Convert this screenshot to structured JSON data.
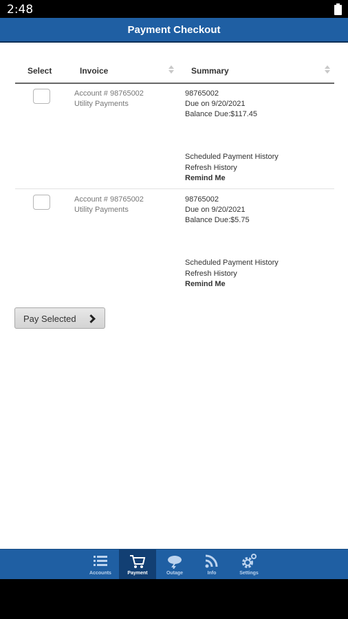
{
  "status_bar": {
    "time": "2:48"
  },
  "header": {
    "title": "Payment Checkout"
  },
  "table": {
    "columns": {
      "select": "Select",
      "invoice": "Invoice",
      "summary": "Summary"
    },
    "rows": [
      {
        "account": "Account # 98765002",
        "type": "Utility Payments",
        "number": "98765002",
        "due": "Due on 9/20/2021",
        "balance": "Balance Due:$117.45",
        "history_link": "Scheduled Payment History",
        "refresh_link": "Refresh History",
        "remind_link": "Remind Me"
      },
      {
        "account": "Account # 98765002",
        "type": "Utility Payments",
        "number": "98765002",
        "due": "Due on 9/20/2021",
        "balance": "Balance Due:$5.75",
        "history_link": "Scheduled Payment History",
        "refresh_link": "Refresh History",
        "remind_link": "Remind Me"
      }
    ]
  },
  "pay_button": {
    "label": "Pay Selected"
  },
  "tab_bar": {
    "active": "Payment",
    "tabs": [
      {
        "label": "Accounts",
        "icon": "list-icon"
      },
      {
        "label": "Payment",
        "icon": "cart-icon"
      },
      {
        "label": "Outage",
        "icon": "storm-cloud-icon"
      },
      {
        "label": "Info",
        "icon": "rss-icon"
      },
      {
        "label": "Settings",
        "icon": "gear-icon"
      }
    ]
  },
  "colors": {
    "header_blue": "#1f5fa3",
    "active_tab": "#123f73"
  }
}
